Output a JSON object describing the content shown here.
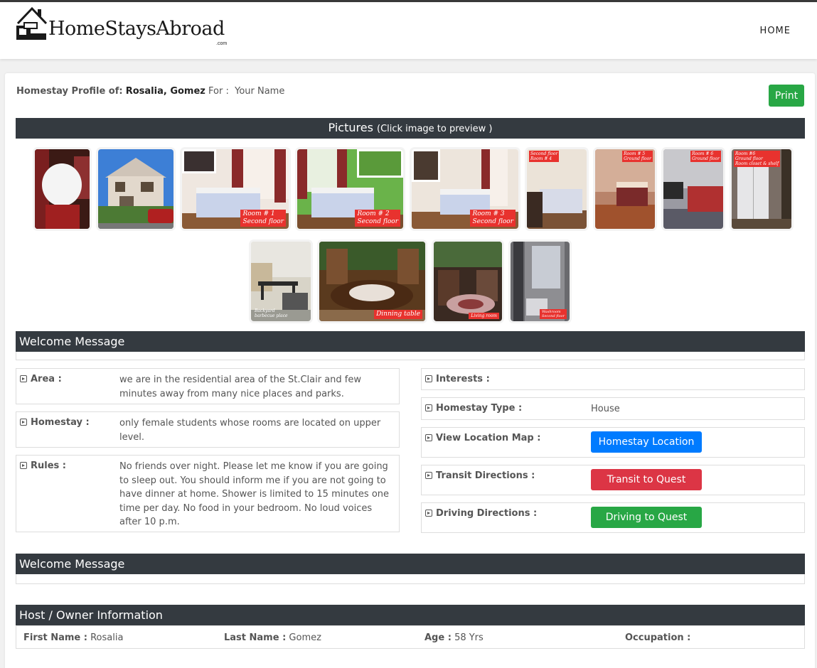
{
  "site": {
    "logo_text": "HomeStaysAbroad",
    "logo_suffix": ".com",
    "nav_home": "HOME"
  },
  "profile": {
    "label": "Homestay Profile of:",
    "host_name": "Rosalia, Gomez",
    "for_label": "For :",
    "for_value": "Your Name",
    "print_label": "Print"
  },
  "pictures": {
    "title": "Pictures",
    "hint": "(Click image to preview )",
    "items": [
      {
        "label": "",
        "top_left": "",
        "top_right": ""
      },
      {
        "label": "",
        "top_left": "",
        "top_right": ""
      },
      {
        "label": "Room # 1\nSecond floor",
        "top_left": "",
        "top_right": ""
      },
      {
        "label": "Room # 2\nSecond floor",
        "top_left": "",
        "top_right": ""
      },
      {
        "label": "Room # 3\nSecond floor",
        "top_left": "",
        "top_right": ""
      },
      {
        "label": "",
        "top_left": "Second floor\nRoom # 4",
        "top_right": ""
      },
      {
        "label": "",
        "top_left": "",
        "top_right": "Room # 5\nGround floor"
      },
      {
        "label": "",
        "top_left": "",
        "top_right": "Room # 6\nGround floor"
      },
      {
        "label": "",
        "top_left": "Room #6\nGround floor\nRoom closet & shelf",
        "top_right": ""
      },
      {
        "label": "Backyard\nbarbecue place",
        "top_left": "",
        "top_right": ""
      },
      {
        "label": "Dinning table",
        "top_left": "",
        "top_right": ""
      },
      {
        "label": "Living room",
        "top_left": "",
        "top_right": ""
      },
      {
        "label": "Washroom\nSecond floor",
        "top_left": "",
        "top_right": ""
      }
    ]
  },
  "welcome": {
    "title": "Welcome Message",
    "title2": "Welcome Message"
  },
  "details_left": [
    {
      "key": "Area :",
      "value": "we are in the residential area of the St.Clair and few minutes away from many nice places and parks."
    },
    {
      "key": "Homestay :",
      "value": "only female students whose rooms are located on upper level."
    },
    {
      "key": "Rules :",
      "value": "No friends over night. Please let me know if you are going to sleep out. You should inform me if you are not going to have dinner at home. Shower is limited to 15 minutes one time per day. No food in your bedroom. No loud voices after 10 p.m."
    }
  ],
  "details_right": {
    "interests_label": "Interests :",
    "type_label": "Homestay Type :",
    "type_value": "House",
    "map_label": "View Location Map :",
    "map_button": "Homestay Location",
    "transit_label": "Transit Directions :",
    "transit_button": "Transit to Quest",
    "driving_label": "Driving Directions :",
    "driving_button": "Driving to Quest"
  },
  "host": {
    "title": "Host / Owner Information",
    "first_name_label": "First Name :",
    "first_name": "Rosalia",
    "last_name_label": "Last Name :",
    "last_name": "Gomez",
    "age_label": "Age :",
    "age": "58 Yrs",
    "occupation_label": "Occupation :",
    "occupation": ""
  },
  "colors": {
    "bar": "#343a40",
    "print": "#28a745",
    "primary": "#007bff",
    "danger": "#dc3545",
    "success": "#28a745",
    "photo_label": "#e8322e"
  }
}
